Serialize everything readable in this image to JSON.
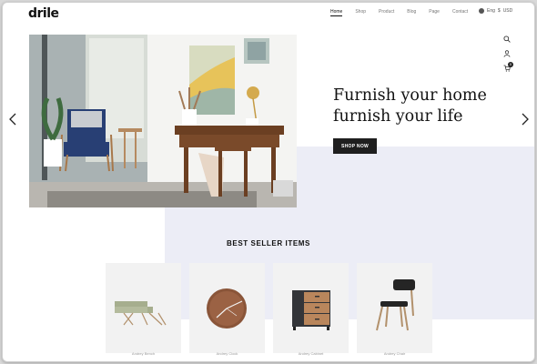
{
  "brand": {
    "logo": "drile"
  },
  "nav": {
    "items": [
      "Home",
      "Shop",
      "Product",
      "Blog",
      "Page",
      "Contact"
    ],
    "active": "Home"
  },
  "locale": {
    "language": "Eng",
    "currency": "USD"
  },
  "header_icons": [
    "search-icon",
    "user-icon",
    "cart-icon"
  ],
  "cart": {
    "count": "0"
  },
  "hero": {
    "headline_line1": "Furnish your home",
    "headline_line2": "furnish your life",
    "cta_label": "SHOP NOW"
  },
  "bestseller": {
    "title": "BEST SELLER ITEMS",
    "products": [
      {
        "caption": "Andrey Bench",
        "icon": "sofa-icon"
      },
      {
        "caption": "Andrey Clock",
        "icon": "clock-icon"
      },
      {
        "caption": "Andrey Cabinet",
        "icon": "cabinet-icon"
      },
      {
        "caption": "Andrey Chair",
        "icon": "chair-icon"
      }
    ]
  },
  "colors": {
    "accent_bg": "#ecedf6",
    "button": "#1f1f1f",
    "text": "#111111"
  }
}
